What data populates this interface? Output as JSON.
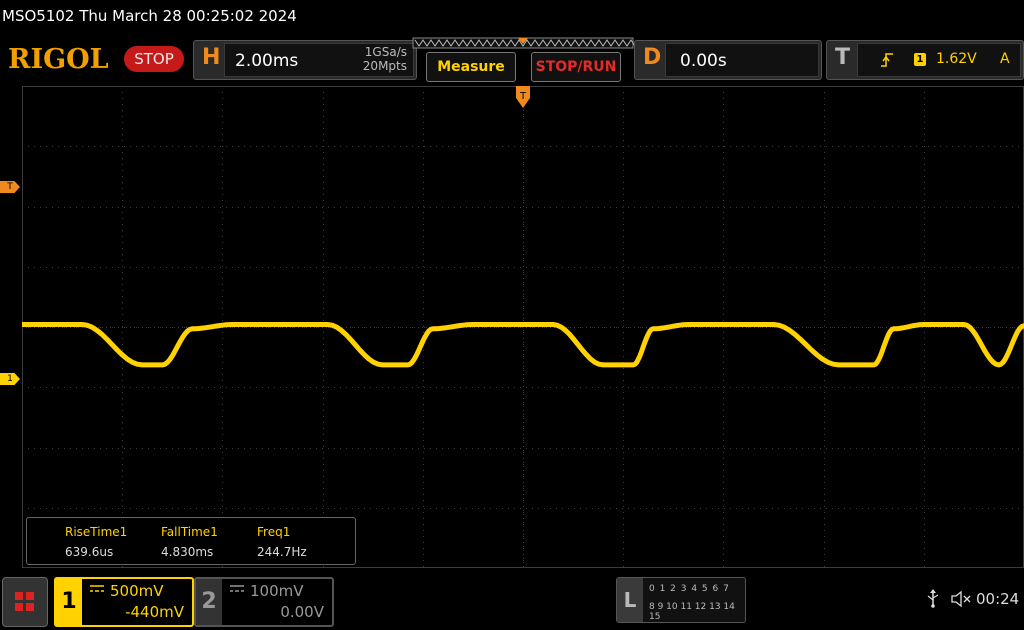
{
  "title": "MSO5102  Thu March 28 00:25:02 2024",
  "brand": {
    "logo": "RIGOL",
    "status": "STOP"
  },
  "horizontal": {
    "letter": "H",
    "timebase": "2.00ms",
    "sample_rate": "1GSa/s",
    "memory_depth": "20Mpts"
  },
  "buttons": {
    "measure": "Measure",
    "stop_run": "STOP/RUN"
  },
  "delay": {
    "letter": "D",
    "value": "0.00s"
  },
  "trigger": {
    "letter": "T",
    "edge_icon": "rising-edge-icon",
    "edge_glyph": "⊥̸",
    "source": "1",
    "level": "1.62V",
    "mode": "A"
  },
  "markers": {
    "trigger_level": "T",
    "ch1_ground": "1"
  },
  "measurements": [
    {
      "name": "RiseTime1",
      "value": "639.6us"
    },
    {
      "name": "FallTime1",
      "value": "4.830ms"
    },
    {
      "name": "Freq1",
      "value": "244.7Hz"
    }
  ],
  "channels": [
    {
      "number": "1",
      "scale": "500mV",
      "offset": "-440mV",
      "coupling": "DC",
      "active": true,
      "color": "#ffd200"
    },
    {
      "number": "2",
      "scale": "100mV",
      "offset": "0.00V",
      "coupling": "DC",
      "active": false,
      "color": "#999999"
    }
  ],
  "logic_analyzer": {
    "letter": "L",
    "row1": "0 1 2 3  4 5 6 7",
    "row2": "8 9 10 11 12 13 14 15"
  },
  "status_bar": {
    "usb_icon": "usb-icon",
    "speaker_icon": "speaker-muted-icon",
    "time": "00:24"
  },
  "colors": {
    "ch1": "#ffd200",
    "accent_orange": "#f08a1c",
    "stop_red": "#c61a1a",
    "grid": "#3c3c3c"
  },
  "chart_data": {
    "type": "line",
    "title": "",
    "xlabel": "",
    "ylabel": "",
    "x_unit": "ms",
    "x_per_div": 2.0,
    "y_per_div_mV": 500,
    "divisions": {
      "x": 10,
      "y": 8
    },
    "xlim": [
      -10,
      10
    ],
    "ylim_divisions": [
      -4,
      4
    ],
    "grid": true,
    "series": [
      {
        "x": [
          -10.0,
          -8.8,
          -7.6,
          -7.2,
          -6.6,
          -5.8,
          -4.8,
          -3.9,
          -2.8,
          -2.3,
          -1.8,
          -1.0,
          0.0,
          0.6,
          1.6,
          2.2,
          2.6,
          3.3,
          4.2,
          5.0,
          6.3,
          7.0,
          7.4,
          8.0,
          8.8,
          9.5,
          10.0
        ],
        "y_div": [
          1.02,
          1.02,
          0.35,
          0.35,
          0.95,
          1.02,
          1.02,
          1.02,
          0.35,
          0.35,
          0.95,
          1.02,
          1.02,
          1.02,
          0.35,
          0.35,
          0.95,
          1.02,
          1.02,
          1.02,
          0.35,
          0.35,
          0.95,
          1.02,
          1.02,
          0.35,
          1.0
        ]
      }
    ]
  }
}
